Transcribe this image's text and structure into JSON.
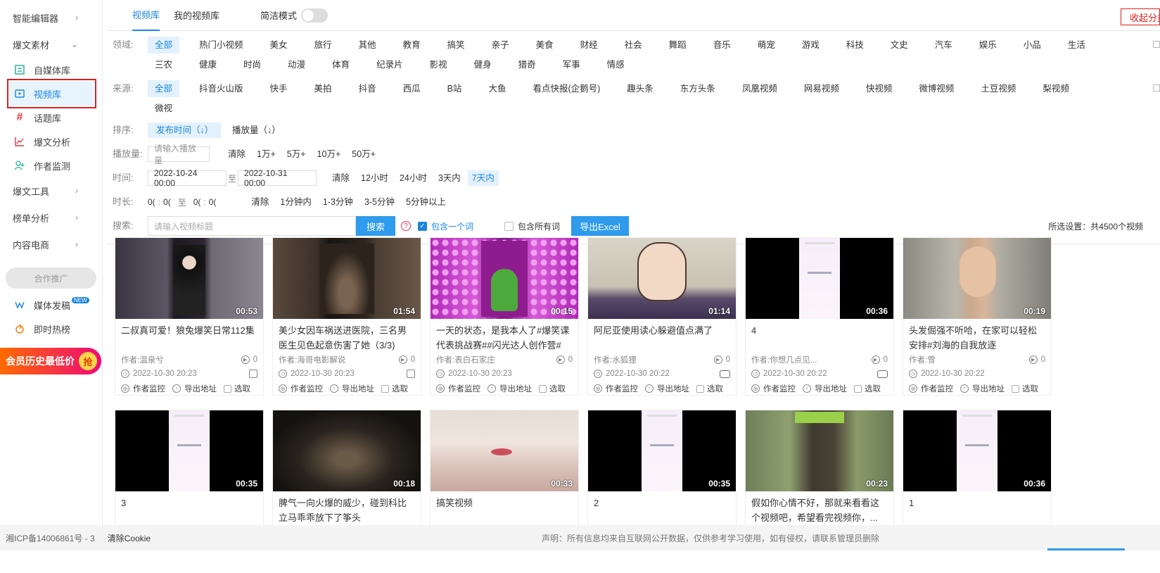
{
  "sidebar": {
    "groups": [
      {
        "label": "智能编辑器",
        "chev": "›"
      },
      {
        "label": "爆文素材",
        "chev": "⌄"
      }
    ],
    "items": [
      {
        "label": "自媒体库"
      },
      {
        "label": "视频库"
      },
      {
        "label": "话题库"
      },
      {
        "label": "爆文分析"
      },
      {
        "label": "作者监测"
      }
    ],
    "groups2": [
      {
        "label": "爆文工具",
        "chev": "›"
      },
      {
        "label": "榜单分析",
        "chev": "›"
      },
      {
        "label": "内容电商",
        "chev": "›"
      }
    ],
    "partner": "合作推广",
    "media_post": "媒体发稿",
    "new_badge": "NEW",
    "hot_rank": "即时热榜",
    "promo_text": "会员历史最低价",
    "promo_grab": "抢"
  },
  "header": {
    "tab_library": "视频库",
    "tab_my_library": "我的视频库",
    "simple_mode": "简洁模式",
    "collapse": "收起分类"
  },
  "filters": {
    "domain_label": "领域:",
    "domain_chips": [
      "全部",
      "热门小视频",
      "美女",
      "旅行",
      "其他",
      "教育",
      "搞笑",
      "亲子",
      "美食",
      "财经",
      "社会",
      "舞蹈",
      "音乐",
      "萌宠",
      "游戏",
      "科技",
      "文史",
      "汽车",
      "娱乐",
      "小品",
      "生活",
      "三农",
      "健康",
      "时尚",
      "动漫",
      "体育",
      "纪录片",
      "影视",
      "健身",
      "猎奇",
      "军事",
      "情感"
    ],
    "source_label": "来源:",
    "source_chips": [
      "全部",
      "抖音火山版",
      "快手",
      "美拍",
      "抖音",
      "西瓜",
      "B站",
      "大鱼",
      "看点快报(企鹅号)",
      "趣头条",
      "东方头条",
      "凤凰视频",
      "网易视频",
      "快视频",
      "微博视频",
      "土豆视频",
      "梨视频",
      "微视"
    ],
    "sort_label": "排序:",
    "sort_publish": "发布时间（↓）",
    "sort_play": "播放量（↓）",
    "plays_label": "播放量:",
    "plays_placeholder": "请输入播放量",
    "plays_opts": [
      "清除",
      "1万+",
      "5万+",
      "10万+",
      "50万+"
    ],
    "time_label": "时间:",
    "time_from": "2022-10-24 00:00",
    "time_to_sep": "至",
    "time_to": "2022-10-31 00:00",
    "time_opts": [
      "清除",
      "12小时",
      "24小时",
      "3天内",
      "7天内"
    ],
    "duration_label": "时长:",
    "dur_from_h": "0(",
    "dur_from_m": "0(",
    "dur_sep": "至",
    "dur_to_h": "0(",
    "dur_to_m": "0(",
    "colon": ":",
    "dur_opts": [
      "清除",
      "1分钟内",
      "1-3分钟",
      "3-5分钟",
      "5分钟以上"
    ],
    "search_label": "搜索:",
    "search_placeholder": "请输入视频标题",
    "search_btn": "搜索",
    "help": "?",
    "include_one": "包含一个词",
    "include_all": "包含所有词",
    "export_btn": "导出Excel",
    "total": "所选设置：共4500个视频"
  },
  "card_labels": {
    "monitor": "作者监控",
    "export_addr": "导出地址",
    "select": "选取"
  },
  "videos": [
    {
      "duration": "00:53",
      "title": "二叔真可爱！狼兔爆笑日常112集",
      "author": "作者:温泉兮",
      "plays": "0",
      "time": "2022-10-30 20:23"
    },
    {
      "duration": "01:54",
      "title": "美少女因车祸送进医院，三名男医生见色起意伤害了她（3/3)",
      "author": "作者:海哥电影解说",
      "plays": "0",
      "time": "2022-10-30 20:23"
    },
    {
      "duration": "00:15",
      "title": "一天的状态，是我本人了#爆笑课代表挑战赛##闪光达人创作营#",
      "author": "作者:表白石家庄",
      "plays": "0",
      "time": "2022-10-30 20:23"
    },
    {
      "duration": "01:14",
      "title": "阿尼亚使用读心躲避值点满了",
      "author": "作者:水狐狸",
      "plays": "0",
      "time": "2022-10-30 20:22"
    },
    {
      "duration": "00:36",
      "title": "4",
      "author": "作者:你想几点见...",
      "plays": "0",
      "time": "2022-10-30 20:22"
    },
    {
      "duration": "00:19",
      "title": "头发倔强不听哈，在家可以轻松安排#刘海的自我放逐",
      "author": "作者:雪",
      "plays": "0",
      "time": "2022-10-30 20:22"
    },
    {
      "duration": "00:35",
      "title": "3"
    },
    {
      "duration": "00:18",
      "title": "脾气一向火爆的威少，碰到科比立马乖乖放下了筝头"
    },
    {
      "duration": "00:33",
      "title": "搞笑视频"
    },
    {
      "duration": "00:35",
      "title": "2"
    },
    {
      "duration": "00:23",
      "title": "假如你心情不好，那就来看看这个视频吧，希望看完视频你，..."
    },
    {
      "duration": "00:36",
      "title": "1"
    }
  ],
  "footer": {
    "icp": "湘ICP备14006861号 - 3",
    "cookie": "清除Cookie",
    "statement": "声明：所有信息均来自互联网公开数据，仅供参考学习使用，如有侵权，请联系管理员删除"
  }
}
